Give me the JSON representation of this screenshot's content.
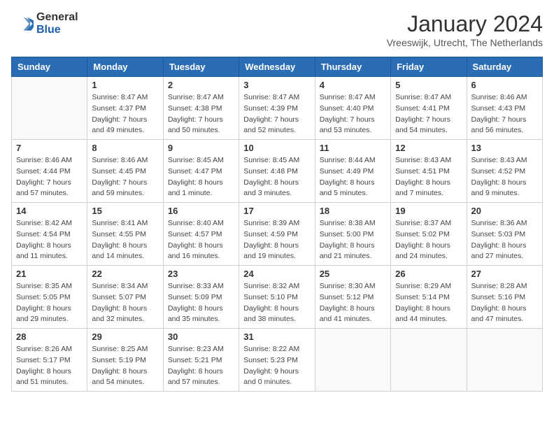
{
  "header": {
    "logo": {
      "general": "General",
      "blue": "Blue"
    },
    "title": "January 2024",
    "location": "Vreeswijk, Utrecht, The Netherlands"
  },
  "days_of_week": [
    "Sunday",
    "Monday",
    "Tuesday",
    "Wednesday",
    "Thursday",
    "Friday",
    "Saturday"
  ],
  "weeks": [
    [
      {
        "day": "",
        "info": []
      },
      {
        "day": "1",
        "info": [
          "Sunrise: 8:47 AM",
          "Sunset: 4:37 PM",
          "Daylight: 7 hours",
          "and 49 minutes."
        ]
      },
      {
        "day": "2",
        "info": [
          "Sunrise: 8:47 AM",
          "Sunset: 4:38 PM",
          "Daylight: 7 hours",
          "and 50 minutes."
        ]
      },
      {
        "day": "3",
        "info": [
          "Sunrise: 8:47 AM",
          "Sunset: 4:39 PM",
          "Daylight: 7 hours",
          "and 52 minutes."
        ]
      },
      {
        "day": "4",
        "info": [
          "Sunrise: 8:47 AM",
          "Sunset: 4:40 PM",
          "Daylight: 7 hours",
          "and 53 minutes."
        ]
      },
      {
        "day": "5",
        "info": [
          "Sunrise: 8:47 AM",
          "Sunset: 4:41 PM",
          "Daylight: 7 hours",
          "and 54 minutes."
        ]
      },
      {
        "day": "6",
        "info": [
          "Sunrise: 8:46 AM",
          "Sunset: 4:43 PM",
          "Daylight: 7 hours",
          "and 56 minutes."
        ]
      }
    ],
    [
      {
        "day": "7",
        "info": [
          "Sunrise: 8:46 AM",
          "Sunset: 4:44 PM",
          "Daylight: 7 hours",
          "and 57 minutes."
        ]
      },
      {
        "day": "8",
        "info": [
          "Sunrise: 8:46 AM",
          "Sunset: 4:45 PM",
          "Daylight: 7 hours",
          "and 59 minutes."
        ]
      },
      {
        "day": "9",
        "info": [
          "Sunrise: 8:45 AM",
          "Sunset: 4:47 PM",
          "Daylight: 8 hours",
          "and 1 minute."
        ]
      },
      {
        "day": "10",
        "info": [
          "Sunrise: 8:45 AM",
          "Sunset: 4:48 PM",
          "Daylight: 8 hours",
          "and 3 minutes."
        ]
      },
      {
        "day": "11",
        "info": [
          "Sunrise: 8:44 AM",
          "Sunset: 4:49 PM",
          "Daylight: 8 hours",
          "and 5 minutes."
        ]
      },
      {
        "day": "12",
        "info": [
          "Sunrise: 8:43 AM",
          "Sunset: 4:51 PM",
          "Daylight: 8 hours",
          "and 7 minutes."
        ]
      },
      {
        "day": "13",
        "info": [
          "Sunrise: 8:43 AM",
          "Sunset: 4:52 PM",
          "Daylight: 8 hours",
          "and 9 minutes."
        ]
      }
    ],
    [
      {
        "day": "14",
        "info": [
          "Sunrise: 8:42 AM",
          "Sunset: 4:54 PM",
          "Daylight: 8 hours",
          "and 11 minutes."
        ]
      },
      {
        "day": "15",
        "info": [
          "Sunrise: 8:41 AM",
          "Sunset: 4:55 PM",
          "Daylight: 8 hours",
          "and 14 minutes."
        ]
      },
      {
        "day": "16",
        "info": [
          "Sunrise: 8:40 AM",
          "Sunset: 4:57 PM",
          "Daylight: 8 hours",
          "and 16 minutes."
        ]
      },
      {
        "day": "17",
        "info": [
          "Sunrise: 8:39 AM",
          "Sunset: 4:59 PM",
          "Daylight: 8 hours",
          "and 19 minutes."
        ]
      },
      {
        "day": "18",
        "info": [
          "Sunrise: 8:38 AM",
          "Sunset: 5:00 PM",
          "Daylight: 8 hours",
          "and 21 minutes."
        ]
      },
      {
        "day": "19",
        "info": [
          "Sunrise: 8:37 AM",
          "Sunset: 5:02 PM",
          "Daylight: 8 hours",
          "and 24 minutes."
        ]
      },
      {
        "day": "20",
        "info": [
          "Sunrise: 8:36 AM",
          "Sunset: 5:03 PM",
          "Daylight: 8 hours",
          "and 27 minutes."
        ]
      }
    ],
    [
      {
        "day": "21",
        "info": [
          "Sunrise: 8:35 AM",
          "Sunset: 5:05 PM",
          "Daylight: 8 hours",
          "and 29 minutes."
        ]
      },
      {
        "day": "22",
        "info": [
          "Sunrise: 8:34 AM",
          "Sunset: 5:07 PM",
          "Daylight: 8 hours",
          "and 32 minutes."
        ]
      },
      {
        "day": "23",
        "info": [
          "Sunrise: 8:33 AM",
          "Sunset: 5:09 PM",
          "Daylight: 8 hours",
          "and 35 minutes."
        ]
      },
      {
        "day": "24",
        "info": [
          "Sunrise: 8:32 AM",
          "Sunset: 5:10 PM",
          "Daylight: 8 hours",
          "and 38 minutes."
        ]
      },
      {
        "day": "25",
        "info": [
          "Sunrise: 8:30 AM",
          "Sunset: 5:12 PM",
          "Daylight: 8 hours",
          "and 41 minutes."
        ]
      },
      {
        "day": "26",
        "info": [
          "Sunrise: 8:29 AM",
          "Sunset: 5:14 PM",
          "Daylight: 8 hours",
          "and 44 minutes."
        ]
      },
      {
        "day": "27",
        "info": [
          "Sunrise: 8:28 AM",
          "Sunset: 5:16 PM",
          "Daylight: 8 hours",
          "and 47 minutes."
        ]
      }
    ],
    [
      {
        "day": "28",
        "info": [
          "Sunrise: 8:26 AM",
          "Sunset: 5:17 PM",
          "Daylight: 8 hours",
          "and 51 minutes."
        ]
      },
      {
        "day": "29",
        "info": [
          "Sunrise: 8:25 AM",
          "Sunset: 5:19 PM",
          "Daylight: 8 hours",
          "and 54 minutes."
        ]
      },
      {
        "day": "30",
        "info": [
          "Sunrise: 8:23 AM",
          "Sunset: 5:21 PM",
          "Daylight: 8 hours",
          "and 57 minutes."
        ]
      },
      {
        "day": "31",
        "info": [
          "Sunrise: 8:22 AM",
          "Sunset: 5:23 PM",
          "Daylight: 9 hours",
          "and 0 minutes."
        ]
      },
      {
        "day": "",
        "info": []
      },
      {
        "day": "",
        "info": []
      },
      {
        "day": "",
        "info": []
      }
    ]
  ]
}
